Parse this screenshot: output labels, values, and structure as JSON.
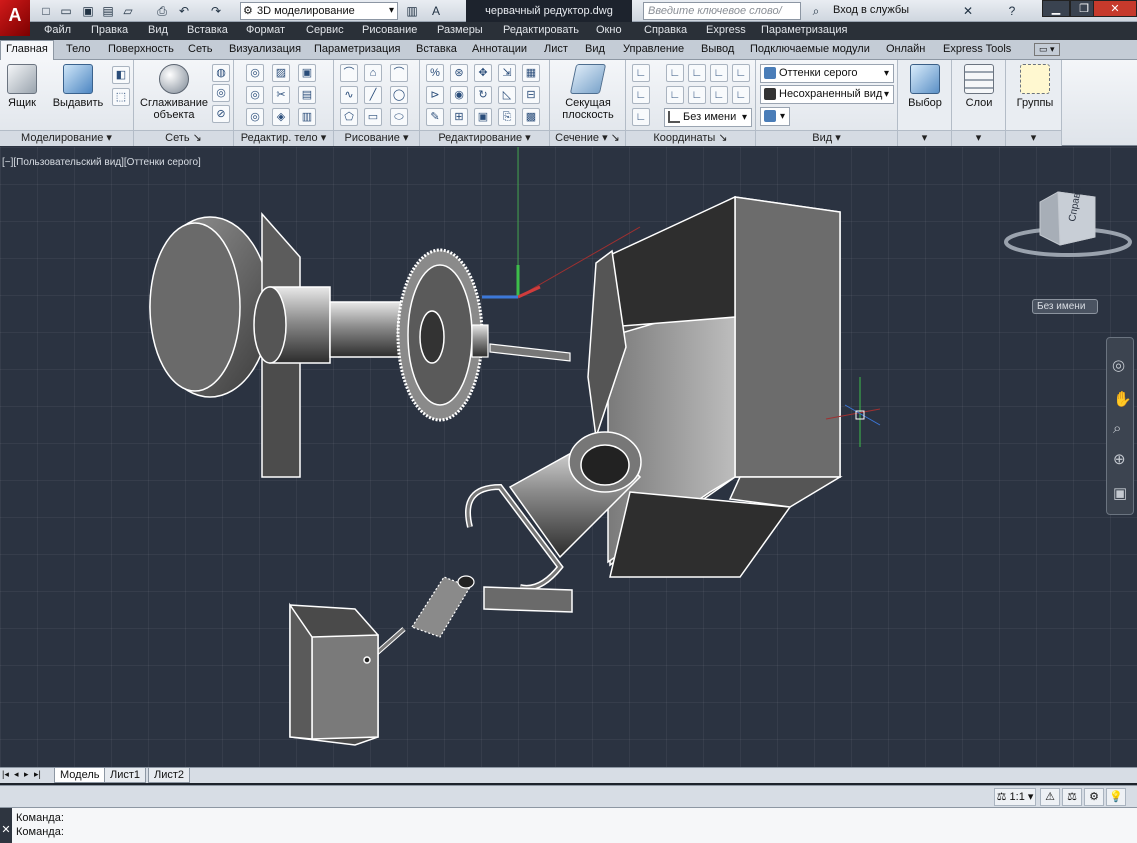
{
  "app": {
    "logo": "A",
    "workspace": "3D моделирование",
    "document": "червачный редуктор.dwg",
    "search_placeholder": "Введите ключевое слово/фразу",
    "signin": "Вход в службы",
    "help": "?"
  },
  "menubar": [
    "Файл",
    "Правка",
    "Вид",
    "Вставка",
    "Формат",
    "Сервис",
    "Рисование",
    "Размеры",
    "Редактировать",
    "Окно",
    "Справка",
    "Express",
    "Параметризация"
  ],
  "ribbon_tabs": [
    "Главная",
    "Тело",
    "Поверхность",
    "Сеть",
    "Визуализация",
    "Параметризация",
    "Вставка",
    "Аннотации",
    "Лист",
    "Вид",
    "Управление",
    "Вывод",
    "Подключаемые модули",
    "Онлайн",
    "Express Tools"
  ],
  "ribbon": {
    "box": "Ящик",
    "extrude": "Выдавить",
    "smooth": "Сглаживание объекта",
    "section_plane": "Секущая плоскость",
    "visual_style": "Оттенки серого",
    "named_view": "Несохраненный вид",
    "ucs_name": "Без имени",
    "select": "Выбор",
    "layers": "Слои",
    "groups": "Группы",
    "panels": {
      "modeling": "Моделирование",
      "mesh": "Сеть",
      "solid_edit": "Редактир. тело",
      "draw": "Рисование",
      "modify": "Редактирование",
      "section": "Сечение",
      "coordinates": "Координаты",
      "view": "Вид"
    }
  },
  "viewport": {
    "label": "[−][Пользовательский вид][Оттенки серого]",
    "viewcube_face": "Справа",
    "ucs_badge": "Без имени"
  },
  "layout_tabs": [
    "Модель",
    "Лист1",
    "Лист2"
  ],
  "status": {
    "scale": "1:1"
  },
  "command": {
    "prompt": "Команда:"
  }
}
